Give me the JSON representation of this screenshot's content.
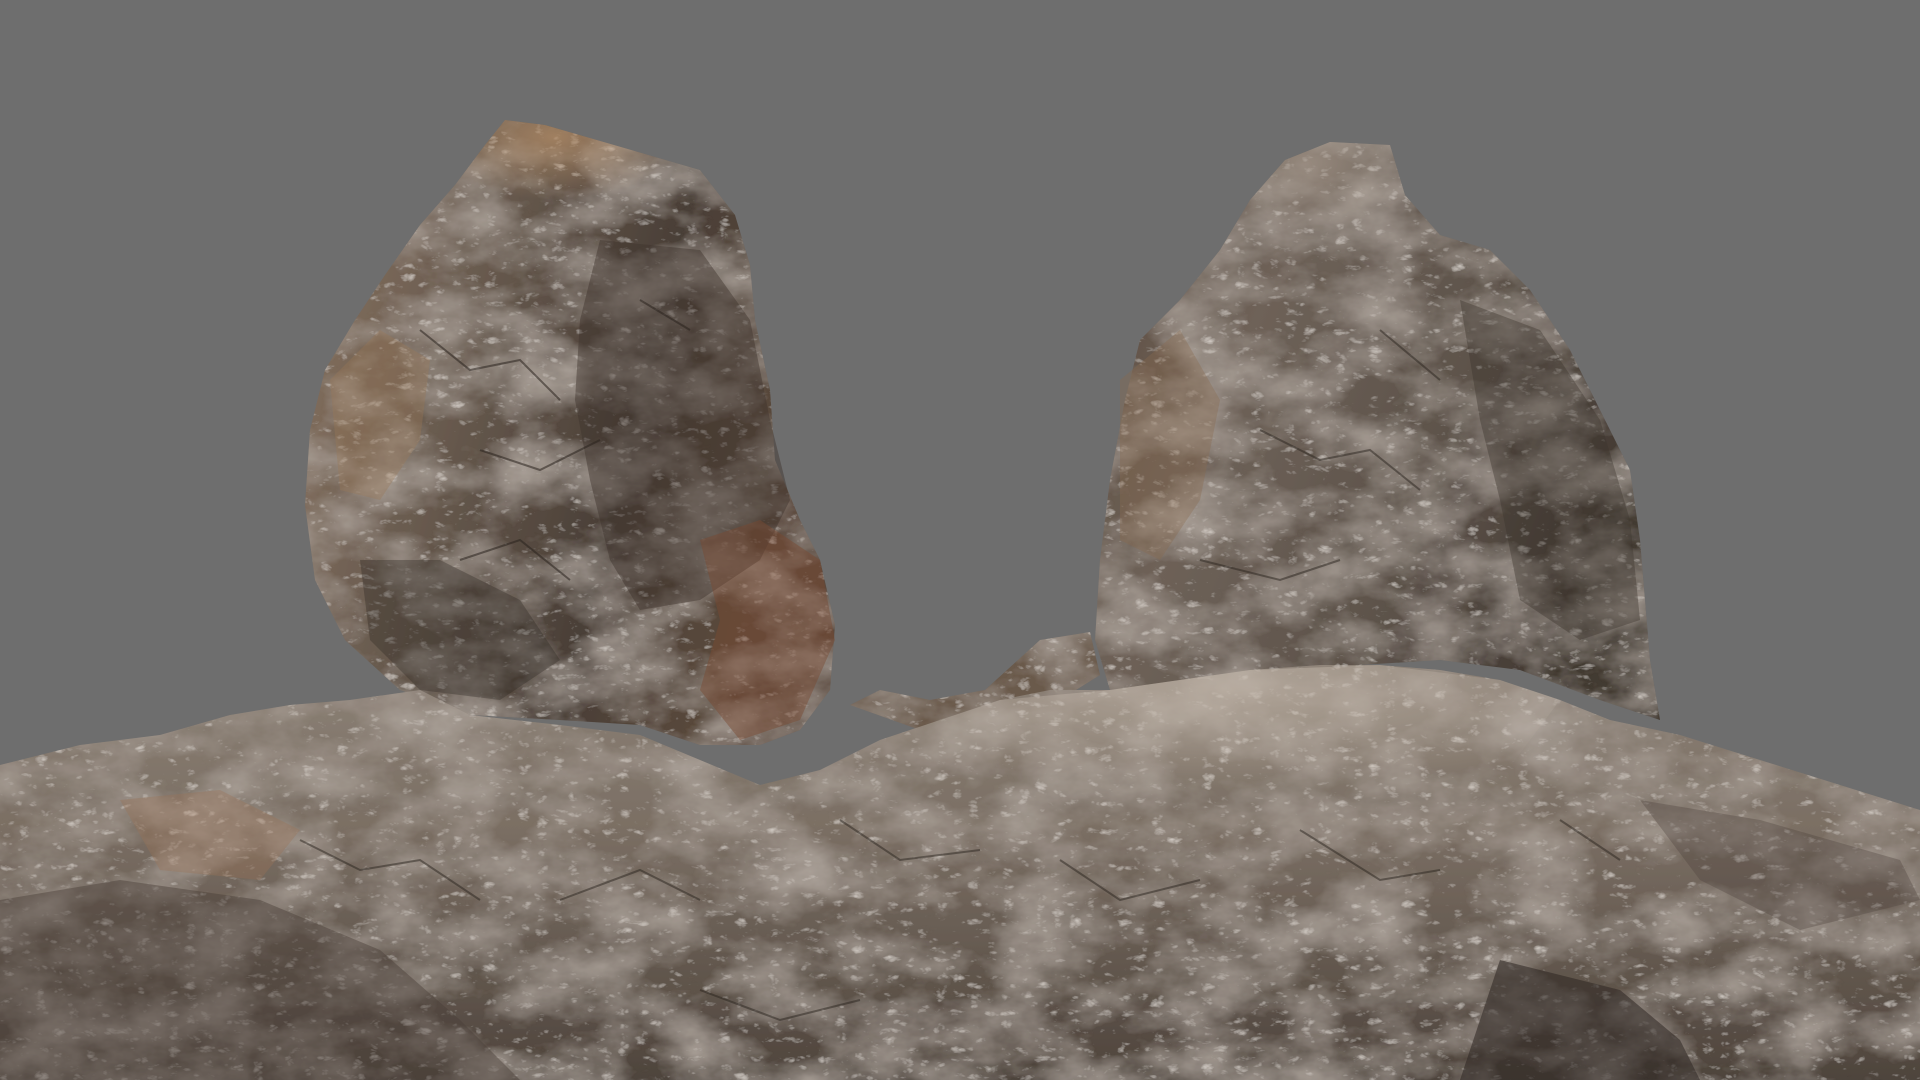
{
  "scene": {
    "description_visible_text": "",
    "colors": {
      "background": "#6e6e6e",
      "rock_dark": "#3b342e",
      "rock_mid": "#6e6257",
      "rock_light": "#a89a8c",
      "rock_highlight": "#c9bfb3",
      "rock_rust": "#8a5a3c"
    },
    "objects": [
      "left-boulder",
      "right-boulder",
      "rock-ledge-base"
    ]
  }
}
